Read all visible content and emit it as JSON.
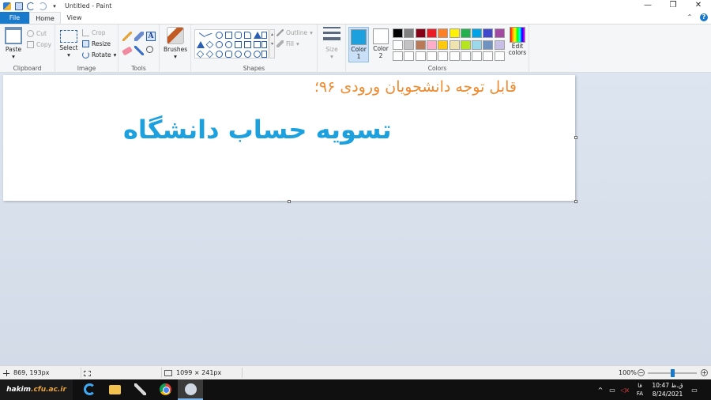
{
  "window": {
    "title": "Untitled - Paint",
    "minimize": "—",
    "maximize": "❐",
    "close": "✕"
  },
  "tabs": {
    "file": "File",
    "home": "Home",
    "view": "View",
    "collapse": "⌃",
    "help": "?"
  },
  "ribbon": {
    "clipboard": {
      "label": "Clipboard",
      "paste": "Paste",
      "cut": "Cut",
      "copy": "Copy"
    },
    "image": {
      "label": "Image",
      "select": "Select",
      "crop": "Crop",
      "resize": "Resize",
      "rotate": "Rotate"
    },
    "tools": {
      "label": "Tools"
    },
    "brushes": {
      "label": "Brushes"
    },
    "shapes": {
      "label": "Shapes",
      "outline": "Outline",
      "fill": "Fill"
    },
    "size": {
      "label": "Size"
    },
    "colors": {
      "label": "Colors",
      "color1": "Color 1",
      "color2": "Color 2",
      "edit": "Edit colors",
      "color1_value": "#1ca1de",
      "color2_value": "#ffffff",
      "palette_row1": [
        "#000000",
        "#7f7f7f",
        "#880015",
        "#ed1c24",
        "#ff7f27",
        "#fff200",
        "#22b14c",
        "#00a2e8",
        "#3f48cc",
        "#a349a4"
      ],
      "palette_row2": [
        "#ffffff",
        "#c3c3c3",
        "#b97a57",
        "#ffaec9",
        "#ffc90e",
        "#efe4b0",
        "#b5e61d",
        "#99d9ea",
        "#7092be",
        "#c8bfe7"
      ],
      "palette_row3": [
        "#ffffff",
        "#ffffff",
        "#ffffff",
        "#ffffff",
        "#ffffff",
        "#ffffff",
        "#ffffff",
        "#ffffff",
        "#ffffff",
        "#ffffff"
      ]
    }
  },
  "canvas": {
    "line1": "قابل توجه دانشجویان ورودی ۹۶؛",
    "line1_color": "#ef8a2f",
    "line2": "تسویه حساب دانشگاه",
    "line2_color": "#1ca1de"
  },
  "statusbar": {
    "cursor_pos": "869, 193px",
    "image_size": "1099 × 241px",
    "zoom": "100%",
    "zoom_out": "−",
    "zoom_in": "+",
    "zoom_level": 0.5
  },
  "taskbar": {
    "watermark_a": "hakim",
    "watermark_b": ".cfu.ac.ir",
    "tray_chevron": "^",
    "tray_network": "▭",
    "tray_volume": "◁x",
    "tray_lang_top": "فا",
    "tray_lang_bottom": "FA",
    "time": "ق.ظ 10:47",
    "date": "8/24/2021",
    "notifications": "▭"
  }
}
